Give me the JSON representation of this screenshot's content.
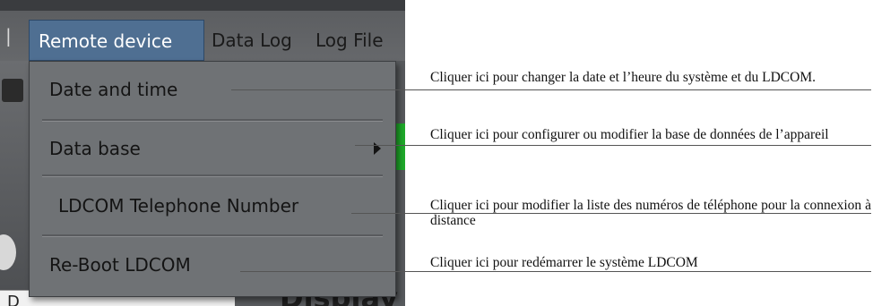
{
  "menubar": {
    "items": [
      {
        "label": "Remote device",
        "active": true
      },
      {
        "label": "Data Log"
      },
      {
        "label": "Log File"
      }
    ]
  },
  "dropdown": {
    "items": [
      {
        "label": "Date and time"
      },
      {
        "label": "Data base",
        "has_submenu": true
      },
      {
        "label": "LDCOM Telephone Number"
      },
      {
        "label": "Re-Boot LDCOM"
      }
    ]
  },
  "background": {
    "field_text": "D",
    "display_label": "Display"
  },
  "annotations": [
    {
      "text": "Cliquer ici pour changer la date et l’heure du système et du LDCOM."
    },
    {
      "text": "Cliquer ici pour configurer ou modifier la base de données de l’appareil"
    },
    {
      "text": "Cliquer ici pour modifier la liste des numéros de téléphone pour la connexion à distance"
    },
    {
      "text": "Cliquer ici pour redémarrer le système LDCOM"
    }
  ],
  "colors": {
    "menu_highlight": "#4f6f92",
    "dropdown_bg": "#6f7275",
    "status_green": "#1faa2a"
  }
}
